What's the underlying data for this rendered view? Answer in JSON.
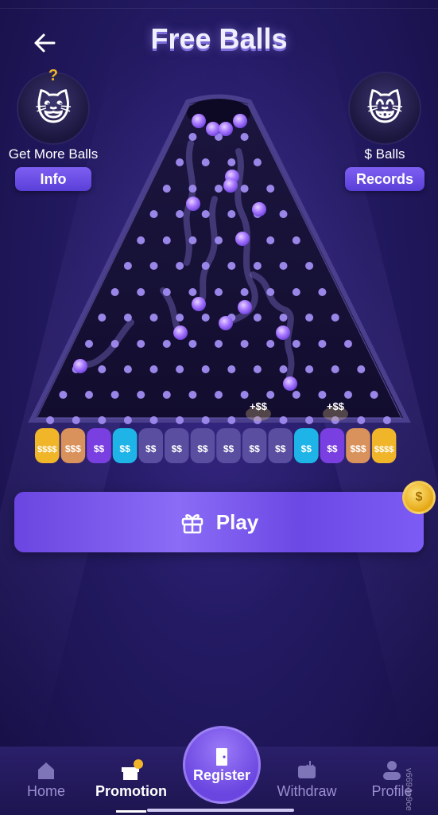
{
  "header": {
    "title": "Free Balls"
  },
  "left_panel": {
    "label": "Get More Balls",
    "button": "Info",
    "badge": "?"
  },
  "right_panel": {
    "label": "$ Balls",
    "button": "Records"
  },
  "board": {
    "bins": [
      "$$$$",
      "$$$",
      "$$",
      "$$",
      "$$",
      "$$",
      "$$",
      "$$",
      "$$",
      "$$",
      "$$",
      "$$",
      "$$$",
      "$$$$"
    ],
    "bin_colors": [
      "#f1b52a",
      "#d9925c",
      "#7a3fe0",
      "#1fb4e8",
      "#5a4ea0",
      "#5a4ea0",
      "#5a4ea0",
      "#5a4ea0",
      "#5a4ea0",
      "#5a4ea0",
      "#1fb4e8",
      "#7a3fe0",
      "#d9925c",
      "#f1b52a"
    ],
    "bonus_labels": [
      "+$$",
      "+$$"
    ]
  },
  "play": {
    "label": "Play"
  },
  "nav": {
    "home": "Home",
    "promotion": "Promotion",
    "register": "Register",
    "withdraw": "Withdraw",
    "profile": "Profile"
  },
  "watermark": "v6694e9ce",
  "colors": {
    "accent": "#7e5ff2",
    "ball": "#a070ff",
    "peg": "#9a86e8"
  }
}
